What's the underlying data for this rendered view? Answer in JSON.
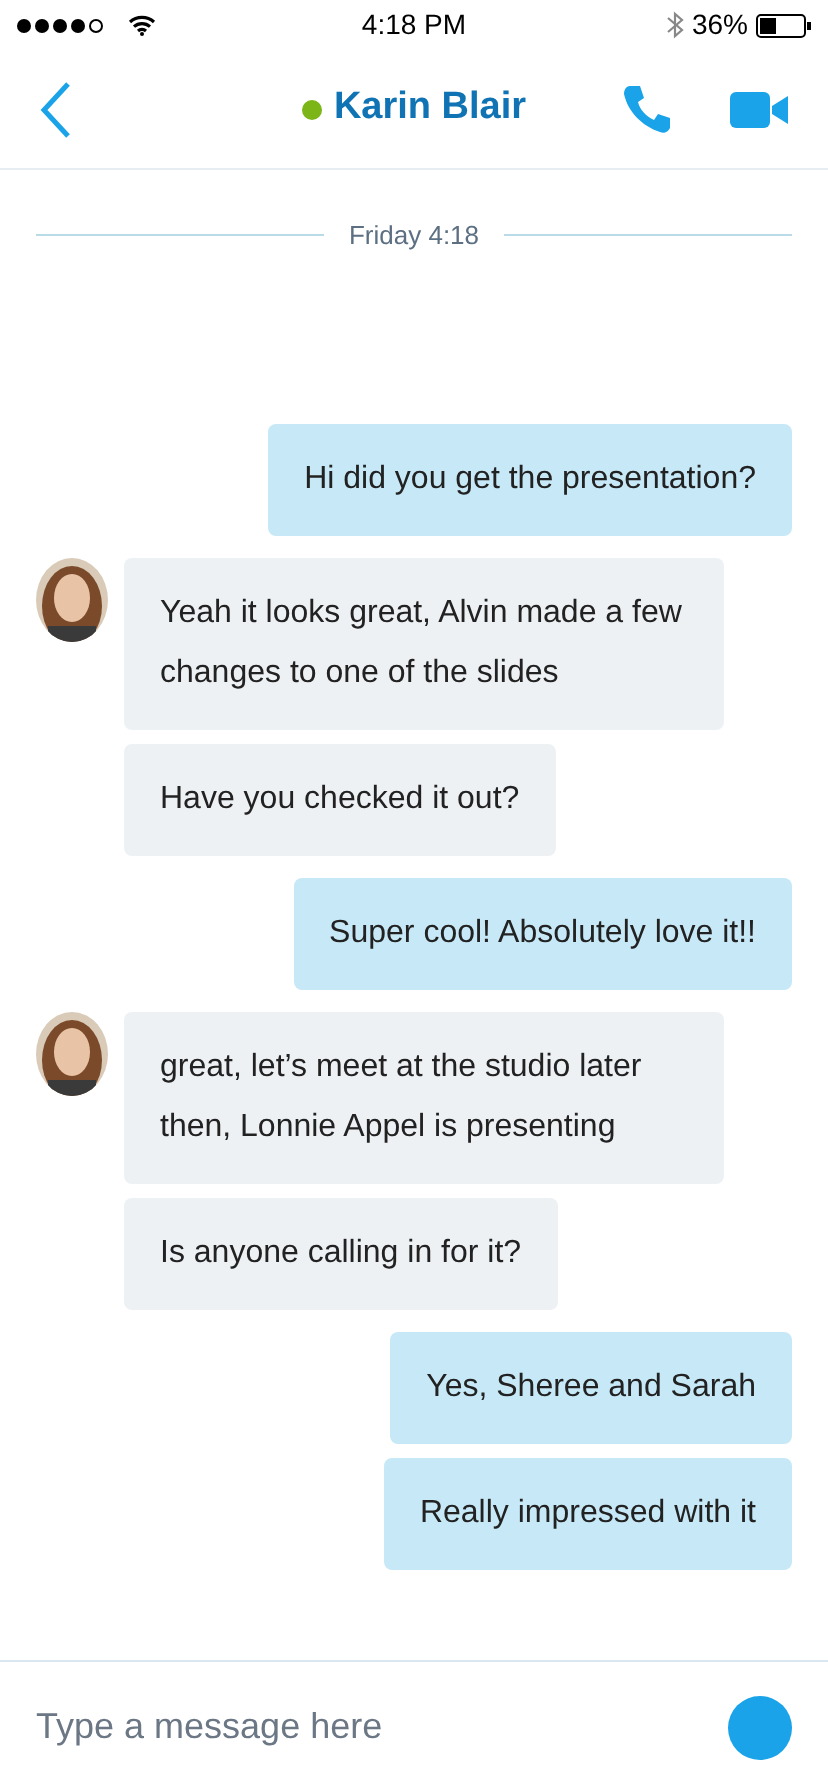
{
  "status_bar": {
    "time": "4:18 PM",
    "battery": "36%"
  },
  "header": {
    "contact": "Karin Blair",
    "online": true
  },
  "date_separator": "Friday 4:18",
  "messages": [
    {
      "kind": "outgoing",
      "text": "Hi did you get the presentation?"
    },
    {
      "kind": "incoming",
      "avatar": true,
      "text": "Yeah it looks great, Alvin made a few changes to one of the slides"
    },
    {
      "kind": "incoming",
      "avatar": false,
      "text": "Have you checked it out?"
    },
    {
      "kind": "outgoing",
      "text": "Super cool! Absolutely love it!!"
    },
    {
      "kind": "incoming",
      "avatar": true,
      "text": "great, let’s meet at the studio later then, Lonnie Appel is presenting"
    },
    {
      "kind": "incoming",
      "avatar": false,
      "text": "Is anyone calling in for it?"
    },
    {
      "kind": "outgoing",
      "text": "Yes, Sheree and Sarah"
    },
    {
      "kind": "outgoing",
      "text": "Really impressed with it"
    }
  ],
  "composer": {
    "placeholder": "Type a message here"
  }
}
